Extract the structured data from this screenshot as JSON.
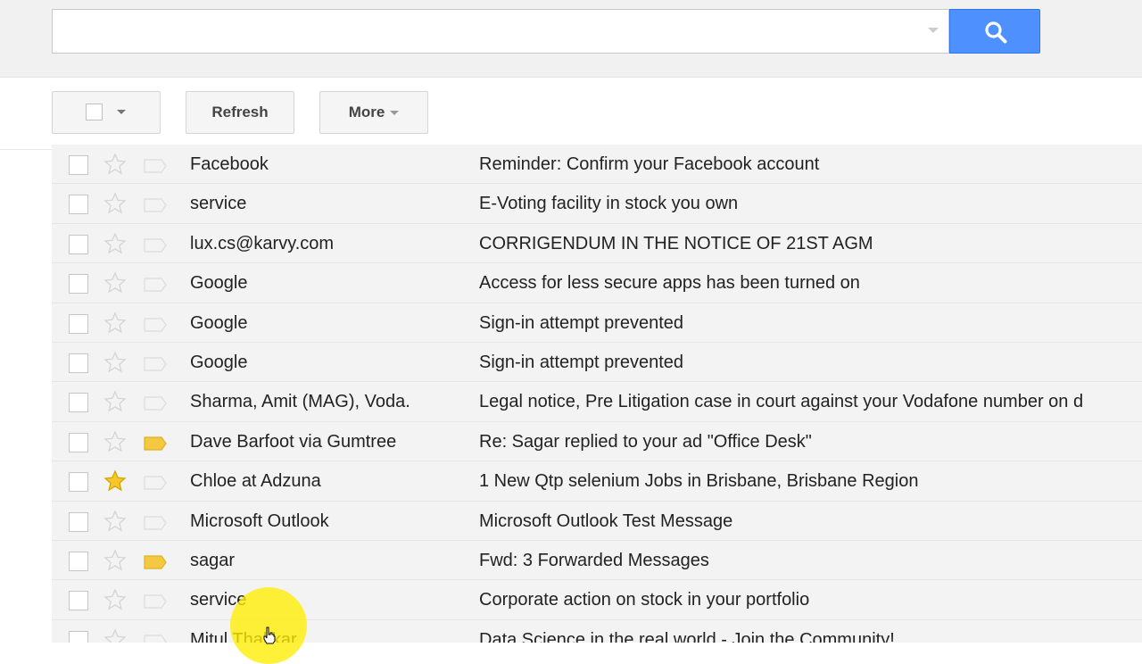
{
  "search": {
    "value": "",
    "placeholder": ""
  },
  "toolbar": {
    "refresh_label": "Refresh",
    "more_label": "More"
  },
  "colors": {
    "search_button": "#4d90fe",
    "star_on": "#f7c72a",
    "important_on": "#f5c842",
    "highlight": "#ffec00"
  },
  "icons": {
    "search": "search-icon",
    "star": "star-icon",
    "important": "important-marker-icon",
    "cursor": "hand-cursor-icon"
  },
  "emails": [
    {
      "sender": "Facebook",
      "subject": "Reminder: Confirm your Facebook account",
      "starred": false,
      "important": false
    },
    {
      "sender": "service",
      "subject": "E-Voting facility in stock you own",
      "starred": false,
      "important": false
    },
    {
      "sender": "lux.cs@karvy.com",
      "subject": "CORRIGENDUM IN THE NOTICE OF 21ST AGM",
      "starred": false,
      "important": false
    },
    {
      "sender": "Google",
      "subject": "Access for less secure apps has been turned on",
      "starred": false,
      "important": false
    },
    {
      "sender": "Google",
      "subject": "Sign-in attempt prevented",
      "starred": false,
      "important": false
    },
    {
      "sender": "Google",
      "subject": "Sign-in attempt prevented",
      "starred": false,
      "important": false
    },
    {
      "sender": "Sharma, Amit (MAG), Voda.",
      "subject": "Legal notice, Pre Litigation case in court against your Vodafone number on d",
      "starred": false,
      "important": false
    },
    {
      "sender": "Dave Barfoot via Gumtree",
      "subject": "Re: Sagar replied to your ad \"Office Desk\"",
      "starred": false,
      "important": true
    },
    {
      "sender": "Chloe at Adzuna",
      "subject": "1 New Qtp selenium Jobs in Brisbane, Brisbane Region",
      "starred": true,
      "important": false
    },
    {
      "sender": "Microsoft Outlook",
      "subject": "Microsoft Outlook Test Message",
      "starred": false,
      "important": false
    },
    {
      "sender": "sagar",
      "subject": "Fwd: 3 Forwarded Messages",
      "starred": false,
      "important": true
    },
    {
      "sender": "service",
      "subject": "Corporate action on stock in your portfolio",
      "starred": false,
      "important": false
    },
    {
      "sender": "Mitul Thakkar",
      "subject": "Data Science in the real world - Join the Community!",
      "starred": false,
      "important": false
    }
  ]
}
